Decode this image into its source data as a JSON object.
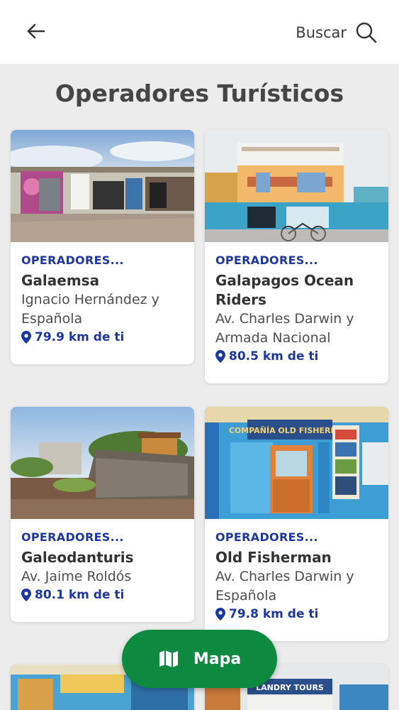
{
  "header": {
    "search_label": "Buscar"
  },
  "page_title": "Operadores Turísticos",
  "cards": [
    {
      "category": "OPERADORES...",
      "name": "Galaemsa",
      "address": [
        "Ignacio Hernández y",
        "Española"
      ],
      "distance": "79.9 km de ti"
    },
    {
      "category": "OPERADORES...",
      "name": [
        "Galapagos Ocean",
        "Riders"
      ],
      "address": [
        "Av. Charles Darwin y",
        "Armada Nacional"
      ],
      "distance": "80.5 km de ti"
    },
    {
      "category": "OPERADORES...",
      "name": "Galeodanturis",
      "address": [
        "Av. Jaime Roldós"
      ],
      "distance": "80.1 km de ti"
    },
    {
      "category": "OPERADORES...",
      "name": "Old Fisherman",
      "address": [
        "Av. Charles Darwin y",
        "Española"
      ],
      "distance": "79.8 km de ti"
    }
  ],
  "photo_signs": {
    "card4_sign": "COMPAÑÍA OLD FISHERMAN",
    "card6_sign": "LANDRY TOURS"
  },
  "map_button": {
    "label": "Mapa"
  },
  "colors": {
    "accent_blue": "#1e37a0",
    "map_green": "#0d8a3f",
    "background": "#ececec"
  }
}
